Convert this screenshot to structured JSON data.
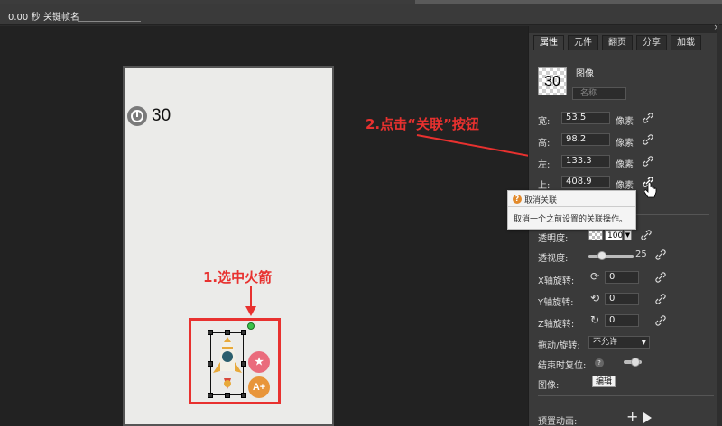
{
  "timebar": {
    "time": "0.00 秒",
    "keyframe_label": "关键帧名",
    "keyframe_value": ""
  },
  "canvas": {
    "timer_value": "30"
  },
  "annotations": {
    "step1": "1.选中火箭",
    "step2": "2.点击“关联”按钮"
  },
  "rocket_buttons": {
    "pink_label": "★",
    "orange_label": "A+"
  },
  "panel": {
    "close": "×",
    "tabs": [
      {
        "label": "属性",
        "active": true
      },
      {
        "label": "元件",
        "active": false
      },
      {
        "label": "翻页",
        "active": false
      },
      {
        "label": "分享",
        "active": false
      },
      {
        "label": "加载",
        "active": false
      }
    ],
    "object": {
      "thumbnail_text": "30",
      "type": "图像",
      "name_placeholder": "名称"
    },
    "props": [
      {
        "label": "宽:",
        "value": "53.5",
        "unit": "像素"
      },
      {
        "label": "高:",
        "value": "98.2",
        "unit": "像素"
      },
      {
        "label": "左:",
        "value": "133.3",
        "unit": "像素"
      },
      {
        "label": "上:",
        "value": "408.9",
        "unit": "像素"
      }
    ],
    "tooltip": {
      "title": "取消关联",
      "body": "取消一个之前设置的关联操作。"
    },
    "opacity": {
      "label": "透明度:",
      "value": "100"
    },
    "perspective": {
      "label": "透视度:",
      "value": "25"
    },
    "x_rotation": {
      "label": "X轴旋转:",
      "value": "0"
    },
    "y_rotation": {
      "label": "Y轴旋转:",
      "value": "0"
    },
    "z_rotation": {
      "label": "Z轴旋转:",
      "value": "0"
    },
    "drag_rotate": {
      "label": "拖动/旋转:",
      "value": "不允许"
    },
    "reset_on_end": {
      "label": "结束时复位:"
    },
    "image": {
      "label": "图像:",
      "button": "编辑"
    },
    "preset_animation": {
      "label": "预置动画:"
    }
  },
  "colors": {
    "annotation_red": "#e8312f",
    "panel_bg": "#3a3a3a",
    "stage_bg": "#222222"
  }
}
